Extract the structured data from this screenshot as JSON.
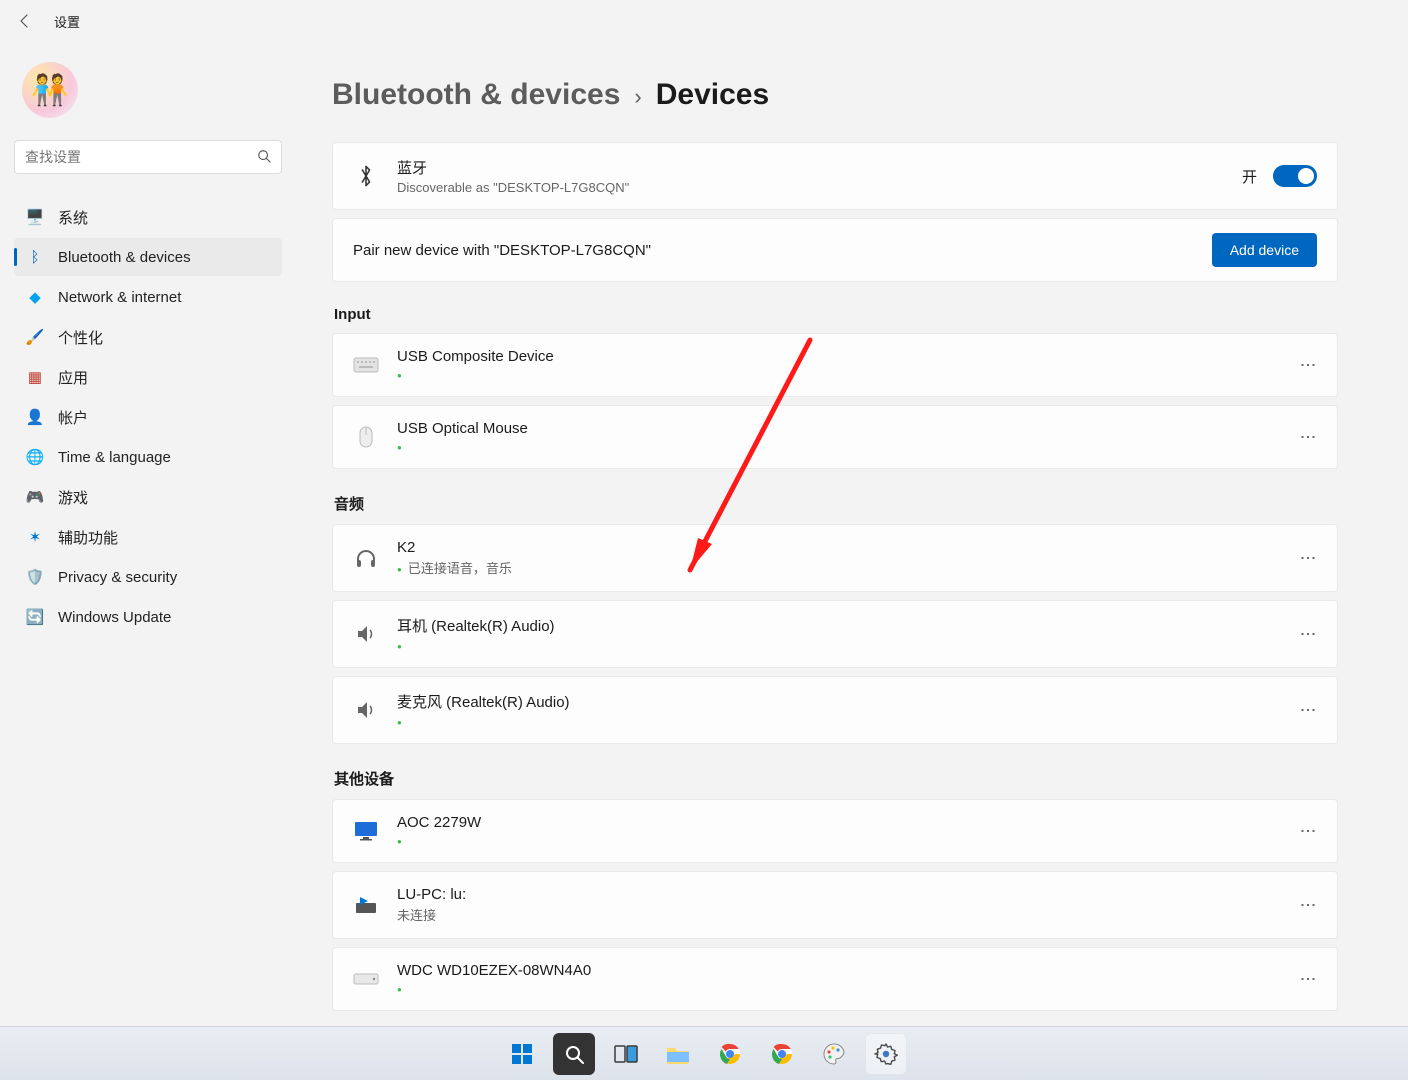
{
  "titlebar": {
    "title": "设置"
  },
  "sidebar": {
    "search_placeholder": "查找设置",
    "items": [
      {
        "icon": "🖥️",
        "label": "系统",
        "color": "#1e90ff"
      },
      {
        "icon": "ᛒ",
        "label": "Bluetooth & devices",
        "color": "#0067c0"
      },
      {
        "icon": "◆",
        "label": "Network & internet",
        "color": "#00a2ed"
      },
      {
        "icon": "🖌️",
        "label": "个性化",
        "color": "#d87a00"
      },
      {
        "icon": "▦",
        "label": "应用",
        "color": "#c0392b"
      },
      {
        "icon": "👤",
        "label": "帐户",
        "color": "#2ecc71"
      },
      {
        "icon": "🌐",
        "label": "Time & language",
        "color": "#1abc9c"
      },
      {
        "icon": "🎮",
        "label": "游戏",
        "color": "#888"
      },
      {
        "icon": "✶",
        "label": "辅助功能",
        "color": "#0078d4"
      },
      {
        "icon": "🛡️",
        "label": "Privacy & security",
        "color": "#607d8b"
      },
      {
        "icon": "🔄",
        "label": "Windows Update",
        "color": "#0078d4"
      }
    ],
    "active_index": 1
  },
  "breadcrumb": {
    "parent": "Bluetooth & devices",
    "current": "Devices"
  },
  "bluetooth": {
    "title": "蓝牙",
    "subtitle": "Discoverable as \"DESKTOP-L7G8CQN\"",
    "state_label": "开"
  },
  "pair": {
    "text": "Pair new device with \"DESKTOP-L7G8CQN\"",
    "button": "Add device"
  },
  "sections": {
    "input": {
      "title": "Input",
      "devices": [
        {
          "icon": "keyboard",
          "name": "USB Composite Device",
          "status_dot": true,
          "status_text": ""
        },
        {
          "icon": "mouse",
          "name": "USB Optical Mouse",
          "status_dot": true,
          "status_text": ""
        }
      ]
    },
    "audio": {
      "title": "音频",
      "devices": [
        {
          "icon": "headphones",
          "name": "K2",
          "status_dot": true,
          "status_text": "已连接语音，音乐"
        },
        {
          "icon": "speaker",
          "name": "耳机 (Realtek(R) Audio)",
          "status_dot": true,
          "status_text": ""
        },
        {
          "icon": "speaker",
          "name": "麦克风 (Realtek(R) Audio)",
          "status_dot": true,
          "status_text": ""
        }
      ]
    },
    "other": {
      "title": "其他设备",
      "devices": [
        {
          "icon": "monitor",
          "name": "AOC 2279W",
          "status_dot": true,
          "status_text": ""
        },
        {
          "icon": "media",
          "name": "LU-PC: lu:",
          "status_dot": false,
          "status_text": "未连接"
        },
        {
          "icon": "hdd",
          "name": "WDC WD10EZEX-08WN4A0",
          "status_dot": true,
          "status_text": ""
        }
      ]
    }
  },
  "taskbar": {
    "items": [
      {
        "name": "start",
        "glyph": "⊞",
        "color": "#0078d4"
      },
      {
        "name": "search",
        "glyph": "🔍",
        "color": "#fff"
      },
      {
        "name": "taskview",
        "glyph": "▢▢",
        "color": "#5aa9e6"
      },
      {
        "name": "explorer",
        "glyph": "📁",
        "color": "#f7c84b"
      },
      {
        "name": "chrome1",
        "glyph": "🟢",
        "color": "#1a73e8"
      },
      {
        "name": "chrome2",
        "glyph": "🔵",
        "color": "#1a73e8"
      },
      {
        "name": "paint",
        "glyph": "🎨",
        "color": "#7aa2ff"
      },
      {
        "name": "settings",
        "glyph": "⚙️",
        "color": "#333",
        "active": true
      }
    ]
  }
}
